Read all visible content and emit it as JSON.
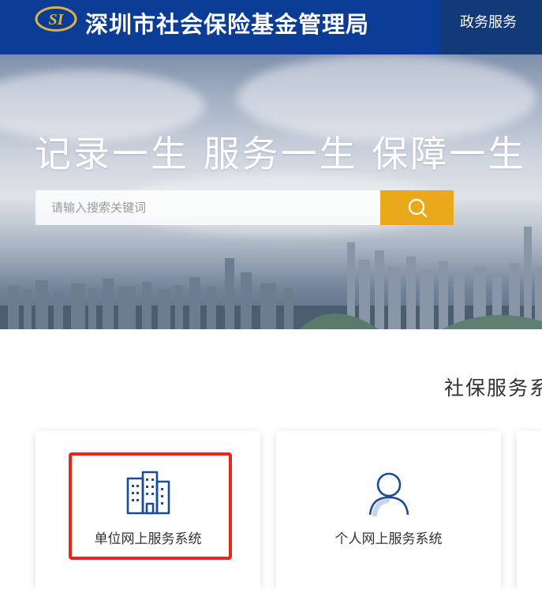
{
  "header": {
    "logo_text": "SI",
    "title": "深圳市社会保险基金管理局",
    "nav": [
      {
        "label": "政务服务"
      }
    ]
  },
  "banner": {
    "slogan": "记录一生  服务一生  保障一生",
    "search": {
      "placeholder": "请输入搜索关键词",
      "value": ""
    }
  },
  "section": {
    "title": "社保服务系",
    "cards": [
      {
        "label": "单位网上服务系统",
        "icon": "building-icon"
      },
      {
        "label": "个人网上服务系统",
        "icon": "person-icon"
      },
      {
        "label": "",
        "icon": ""
      }
    ]
  },
  "colors": {
    "header_bg": "#0b3d96",
    "nav_bg": "#123a78",
    "search_button": "#eaa81b",
    "highlight": "#e8261c",
    "icon_blue": "#1a4a9a"
  }
}
